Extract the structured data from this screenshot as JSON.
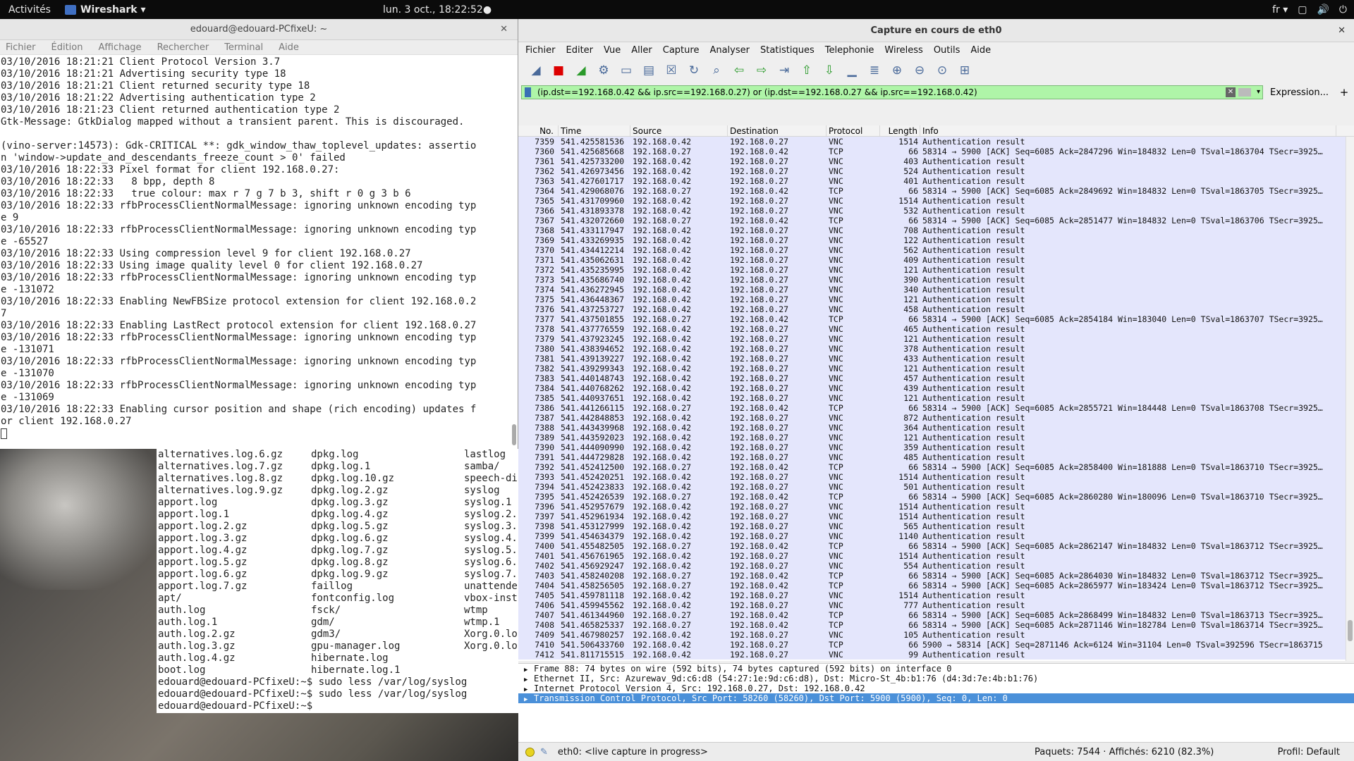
{
  "topbar": {
    "activities": "Activités",
    "app_name": "Wireshark ▾",
    "clock": "lun. 3 oct., 18:22:52●",
    "lang": "fr ▾",
    "icons": [
      "window-icon",
      "volume-icon",
      "power-icon"
    ]
  },
  "terminal": {
    "title": "edouard@edouard-PCfixeU: ~",
    "menu": [
      "Fichier",
      "Édition",
      "Affichage",
      "Rechercher",
      "Terminal",
      "Aide"
    ],
    "lines": [
      "03/10/2016 18:21:21 Client Protocol Version 3.7",
      "03/10/2016 18:21:21 Advertising security type 18",
      "03/10/2016 18:21:21 Client returned security type 18",
      "03/10/2016 18:21:22 Advertising authentication type 2",
      "03/10/2016 18:21:23 Client returned authentication type 2",
      "Gtk-Message: GtkDialog mapped without a transient parent. This is discouraged.",
      "",
      "(vino-server:14573): Gdk-CRITICAL **: gdk_window_thaw_toplevel_updates: assertio",
      "n 'window->update_and_descendants_freeze_count > 0' failed",
      "03/10/2016 18:22:33 Pixel format for client 192.168.0.27:",
      "03/10/2016 18:22:33   8 bpp, depth 8",
      "03/10/2016 18:22:33   true colour: max r 7 g 7 b 3, shift r 0 g 3 b 6",
      "03/10/2016 18:22:33 rfbProcessClientNormalMessage: ignoring unknown encoding typ",
      "e 9",
      "03/10/2016 18:22:33 rfbProcessClientNormalMessage: ignoring unknown encoding typ",
      "e -65527",
      "03/10/2016 18:22:33 Using compression level 9 for client 192.168.0.27",
      "03/10/2016 18:22:33 Using image quality level 0 for client 192.168.0.27",
      "03/10/2016 18:22:33 rfbProcessClientNormalMessage: ignoring unknown encoding typ",
      "e -131072",
      "03/10/2016 18:22:33 Enabling NewFBSize protocol extension for client 192.168.0.2",
      "7",
      "03/10/2016 18:22:33 Enabling LastRect protocol extension for client 192.168.0.27",
      "03/10/2016 18:22:33 rfbProcessClientNormalMessage: ignoring unknown encoding typ",
      "e -131071",
      "03/10/2016 18:22:33 rfbProcessClientNormalMessage: ignoring unknown encoding typ",
      "e -131070",
      "03/10/2016 18:22:33 rfbProcessClientNormalMessage: ignoring unknown encoding typ",
      "e -131069",
      "03/10/2016 18:22:33 Enabling cursor position and shape (rich encoding) updates f",
      "or client 192.168.0.27"
    ]
  },
  "terminal2": {
    "col1": [
      "alternatives.log.6.gz",
      "alternatives.log.7.gz",
      "alternatives.log.8.gz",
      "alternatives.log.9.gz",
      "apport.log",
      "apport.log.1",
      "apport.log.2.gz",
      "apport.log.3.gz",
      "apport.log.4.gz",
      "apport.log.5.gz",
      "apport.log.6.gz",
      "apport.log.7.gz",
      "apt/",
      "auth.log",
      "auth.log.1",
      "auth.log.2.gz",
      "auth.log.3.gz",
      "auth.log.4.gz",
      "boot.log"
    ],
    "col2": [
      "dpkg.log",
      "dpkg.log.1",
      "dpkg.log.10.gz",
      "dpkg.log.2.gz",
      "dpkg.log.3.gz",
      "dpkg.log.4.gz",
      "dpkg.log.5.gz",
      "dpkg.log.6.gz",
      "dpkg.log.7.gz",
      "dpkg.log.8.gz",
      "dpkg.log.9.gz",
      "faillog",
      "fontconfig.log",
      "fsck/",
      "gdm/",
      "gdm3/",
      "gpu-manager.log",
      "hibernate.log",
      "hibernate.log.1"
    ],
    "col3": [
      "lastlog",
      "samba/",
      "speech-di",
      "syslog",
      "syslog.1",
      "syslog.2.",
      "syslog.3.",
      "syslog.4.",
      "syslog.5.",
      "syslog.6.",
      "syslog.7.",
      "unattende",
      "vbox-inst",
      "wtmp",
      "wtmp.1",
      "Xorg.0.lo",
      "Xorg.0.lo",
      "",
      ""
    ],
    "prompts": [
      "edouard@edouard-PCfixeU:~$ sudo less /var/log/syslog",
      "edouard@edouard-PCfixeU:~$ sudo less /var/log/syslog",
      "edouard@edouard-PCfixeU:~$ "
    ]
  },
  "wireshark": {
    "title": "Capture en cours de eth0",
    "menu": [
      "Fichier",
      "Editer",
      "Vue",
      "Aller",
      "Capture",
      "Analyser",
      "Statistiques",
      "Telephonie",
      "Wireless",
      "Outils",
      "Aide"
    ],
    "filter": "(ip.dst==192.168.0.42 && ip.src==192.168.0.27) or (ip.dst==192.168.0.27 && ip.src==192.168.0.42)",
    "expression_label": "Expression...",
    "plus_label": "+",
    "columns": [
      "No.",
      "Time",
      "Source",
      "Destination",
      "Protocol",
      "Length",
      "Info"
    ],
    "packets": [
      [
        "7359",
        "541.425581536",
        "192.168.0.42",
        "192.168.0.27",
        "VNC",
        "1514",
        "Authentication result"
      ],
      [
        "7360",
        "541.425685668",
        "192.168.0.27",
        "192.168.0.42",
        "TCP",
        "66",
        "58314 → 5900 [ACK] Seq=6085 Ack=2847296 Win=184832 Len=0 TSval=1863704 TSecr=3925…"
      ],
      [
        "7361",
        "541.425733200",
        "192.168.0.42",
        "192.168.0.27",
        "VNC",
        "403",
        "Authentication result"
      ],
      [
        "7362",
        "541.426973456",
        "192.168.0.42",
        "192.168.0.27",
        "VNC",
        "524",
        "Authentication result"
      ],
      [
        "7363",
        "541.427601717",
        "192.168.0.42",
        "192.168.0.27",
        "VNC",
        "401",
        "Authentication result"
      ],
      [
        "7364",
        "541.429068076",
        "192.168.0.27",
        "192.168.0.42",
        "TCP",
        "66",
        "58314 → 5900 [ACK] Seq=6085 Ack=2849692 Win=184832 Len=0 TSval=1863705 TSecr=3925…"
      ],
      [
        "7365",
        "541.431709960",
        "192.168.0.42",
        "192.168.0.27",
        "VNC",
        "1514",
        "Authentication result"
      ],
      [
        "7366",
        "541.431893378",
        "192.168.0.42",
        "192.168.0.27",
        "VNC",
        "532",
        "Authentication result"
      ],
      [
        "7367",
        "541.432072660",
        "192.168.0.27",
        "192.168.0.42",
        "TCP",
        "66",
        "58314 → 5900 [ACK] Seq=6085 Ack=2851477 Win=184832 Len=0 TSval=1863706 TSecr=3925…"
      ],
      [
        "7368",
        "541.433117947",
        "192.168.0.42",
        "192.168.0.27",
        "VNC",
        "708",
        "Authentication result"
      ],
      [
        "7369",
        "541.433269935",
        "192.168.0.42",
        "192.168.0.27",
        "VNC",
        "122",
        "Authentication result"
      ],
      [
        "7370",
        "541.434412214",
        "192.168.0.42",
        "192.168.0.27",
        "VNC",
        "562",
        "Authentication result"
      ],
      [
        "7371",
        "541.435062631",
        "192.168.0.42",
        "192.168.0.27",
        "VNC",
        "409",
        "Authentication result"
      ],
      [
        "7372",
        "541.435235995",
        "192.168.0.42",
        "192.168.0.27",
        "VNC",
        "121",
        "Authentication result"
      ],
      [
        "7373",
        "541.435686740",
        "192.168.0.42",
        "192.168.0.27",
        "VNC",
        "390",
        "Authentication result"
      ],
      [
        "7374",
        "541.436272945",
        "192.168.0.42",
        "192.168.0.27",
        "VNC",
        "340",
        "Authentication result"
      ],
      [
        "7375",
        "541.436448367",
        "192.168.0.42",
        "192.168.0.27",
        "VNC",
        "121",
        "Authentication result"
      ],
      [
        "7376",
        "541.437253727",
        "192.168.0.42",
        "192.168.0.27",
        "VNC",
        "458",
        "Authentication result"
      ],
      [
        "7377",
        "541.437501855",
        "192.168.0.27",
        "192.168.0.42",
        "TCP",
        "66",
        "58314 → 5900 [ACK] Seq=6085 Ack=2854184 Win=183040 Len=0 TSval=1863707 TSecr=3925…"
      ],
      [
        "7378",
        "541.437776559",
        "192.168.0.42",
        "192.168.0.27",
        "VNC",
        "465",
        "Authentication result"
      ],
      [
        "7379",
        "541.437923245",
        "192.168.0.42",
        "192.168.0.27",
        "VNC",
        "121",
        "Authentication result"
      ],
      [
        "7380",
        "541.438394652",
        "192.168.0.42",
        "192.168.0.27",
        "VNC",
        "378",
        "Authentication result"
      ],
      [
        "7381",
        "541.439139227",
        "192.168.0.42",
        "192.168.0.27",
        "VNC",
        "433",
        "Authentication result"
      ],
      [
        "7382",
        "541.439299343",
        "192.168.0.42",
        "192.168.0.27",
        "VNC",
        "121",
        "Authentication result"
      ],
      [
        "7383",
        "541.440148743",
        "192.168.0.42",
        "192.168.0.27",
        "VNC",
        "457",
        "Authentication result"
      ],
      [
        "7384",
        "541.440768262",
        "192.168.0.42",
        "192.168.0.27",
        "VNC",
        "439",
        "Authentication result"
      ],
      [
        "7385",
        "541.440937651",
        "192.168.0.42",
        "192.168.0.27",
        "VNC",
        "121",
        "Authentication result"
      ],
      [
        "7386",
        "541.441266115",
        "192.168.0.27",
        "192.168.0.42",
        "TCP",
        "66",
        "58314 → 5900 [ACK] Seq=6085 Ack=2855721 Win=184448 Len=0 TSval=1863708 TSecr=3925…"
      ],
      [
        "7387",
        "541.442848853",
        "192.168.0.42",
        "192.168.0.27",
        "VNC",
        "872",
        "Authentication result"
      ],
      [
        "7388",
        "541.443439968",
        "192.168.0.42",
        "192.168.0.27",
        "VNC",
        "364",
        "Authentication result"
      ],
      [
        "7389",
        "541.443592023",
        "192.168.0.42",
        "192.168.0.27",
        "VNC",
        "121",
        "Authentication result"
      ],
      [
        "7390",
        "541.444090990",
        "192.168.0.42",
        "192.168.0.27",
        "VNC",
        "359",
        "Authentication result"
      ],
      [
        "7391",
        "541.444729828",
        "192.168.0.42",
        "192.168.0.27",
        "VNC",
        "485",
        "Authentication result"
      ],
      [
        "7392",
        "541.452412500",
        "192.168.0.27",
        "192.168.0.42",
        "TCP",
        "66",
        "58314 → 5900 [ACK] Seq=6085 Ack=2858400 Win=181888 Len=0 TSval=1863710 TSecr=3925…"
      ],
      [
        "7393",
        "541.452420251",
        "192.168.0.42",
        "192.168.0.27",
        "VNC",
        "1514",
        "Authentication result"
      ],
      [
        "7394",
        "541.452423833",
        "192.168.0.42",
        "192.168.0.27",
        "VNC",
        "501",
        "Authentication result"
      ],
      [
        "7395",
        "541.452426539",
        "192.168.0.27",
        "192.168.0.42",
        "TCP",
        "66",
        "58314 → 5900 [ACK] Seq=6085 Ack=2860280 Win=180096 Len=0 TSval=1863710 TSecr=3925…"
      ],
      [
        "7396",
        "541.452957679",
        "192.168.0.42",
        "192.168.0.27",
        "VNC",
        "1514",
        "Authentication result"
      ],
      [
        "7397",
        "541.452961934",
        "192.168.0.42",
        "192.168.0.27",
        "VNC",
        "1514",
        "Authentication result"
      ],
      [
        "7398",
        "541.453127999",
        "192.168.0.42",
        "192.168.0.27",
        "VNC",
        "565",
        "Authentication result"
      ],
      [
        "7399",
        "541.454634379",
        "192.168.0.42",
        "192.168.0.27",
        "VNC",
        "1140",
        "Authentication result"
      ],
      [
        "7400",
        "541.455482505",
        "192.168.0.27",
        "192.168.0.42",
        "TCP",
        "66",
        "58314 → 5900 [ACK] Seq=6085 Ack=2862147 Win=184832 Len=0 TSval=1863712 TSecr=3925…"
      ],
      [
        "7401",
        "541.456761965",
        "192.168.0.42",
        "192.168.0.27",
        "VNC",
        "1514",
        "Authentication result"
      ],
      [
        "7402",
        "541.456929247",
        "192.168.0.42",
        "192.168.0.27",
        "VNC",
        "554",
        "Authentication result"
      ],
      [
        "7403",
        "541.458240208",
        "192.168.0.27",
        "192.168.0.42",
        "TCP",
        "66",
        "58314 → 5900 [ACK] Seq=6085 Ack=2864030 Win=184832 Len=0 TSval=1863712 TSecr=3925…"
      ],
      [
        "7404",
        "541.458256505",
        "192.168.0.27",
        "192.168.0.42",
        "TCP",
        "66",
        "58314 → 5900 [ACK] Seq=6085 Ack=2865977 Win=183424 Len=0 TSval=1863712 TSecr=3925…"
      ],
      [
        "7405",
        "541.459781118",
        "192.168.0.42",
        "192.168.0.27",
        "VNC",
        "1514",
        "Authentication result"
      ],
      [
        "7406",
        "541.459945562",
        "192.168.0.42",
        "192.168.0.27",
        "VNC",
        "777",
        "Authentication result"
      ],
      [
        "7407",
        "541.461344960",
        "192.168.0.27",
        "192.168.0.42",
        "TCP",
        "66",
        "58314 → 5900 [ACK] Seq=6085 Ack=2868499 Win=184832 Len=0 TSval=1863713 TSecr=3925…"
      ],
      [
        "7408",
        "541.465825337",
        "192.168.0.27",
        "192.168.0.42",
        "TCP",
        "66",
        "58314 → 5900 [ACK] Seq=6085 Ack=2871146 Win=182784 Len=0 TSval=1863714 TSecr=3925…"
      ],
      [
        "7409",
        "541.467980257",
        "192.168.0.42",
        "192.168.0.27",
        "VNC",
        "105",
        "Authentication result"
      ],
      [
        "7410",
        "541.506433760",
        "192.168.0.42",
        "192.168.0.27",
        "TCP",
        "66",
        "5900 → 58314 [ACK] Seq=2871146 Ack=6124 Win=31104 Len=0 TSval=392596 TSecr=1863715"
      ],
      [
        "7412",
        "541.811715515",
        "192.168.0.42",
        "192.168.0.27",
        "VNC",
        "99",
        "Authentication result"
      ]
    ],
    "details": [
      "Frame 88: 74 bytes on wire (592 bits), 74 bytes captured (592 bits) on interface 0",
      "Ethernet II, Src: Azurewav_9d:c6:d8 (54:27:1e:9d:c6:d8), Dst: Micro-St_4b:b1:76 (d4:3d:7e:4b:b1:76)",
      "Internet Protocol Version 4, Src: 192.168.0.27, Dst: 192.168.0.42",
      "Transmission Control Protocol, Src Port: 58260 (58260), Dst Port: 5900 (5900), Seq: 0, Len: 0"
    ],
    "status": {
      "interface": "eth0: <live capture in progress>",
      "packets": "Paquets: 7544 · Affichés: 6210 (82.3%)",
      "profile": "Profil: Default"
    }
  }
}
